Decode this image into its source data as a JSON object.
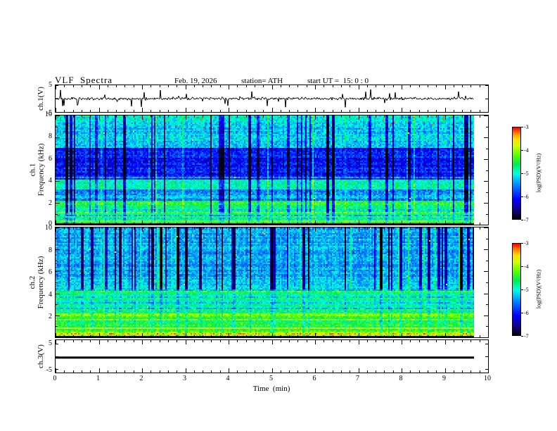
{
  "header": {
    "title": "VLF  Spectra",
    "date": "Feb. 19, 2026",
    "station": "station= ATH",
    "start_ut": "start UT =  15: 0 : 0"
  },
  "axes": {
    "time": {
      "label": "Time  (min)",
      "min": 0,
      "max": 10,
      "ticks": [
        0,
        1,
        2,
        3,
        4,
        5,
        6,
        7,
        8,
        9,
        10
      ]
    },
    "wave1": {
      "label": "ch.1(V)",
      "min": -5,
      "max": 5,
      "ticks": [
        5,
        -5
      ]
    },
    "spec1": {
      "ch": "ch.1",
      "freq_label": "Frequency  (kHz)",
      "min": 0,
      "max": 10,
      "ticks": [
        10,
        8,
        6,
        4,
        2,
        0
      ]
    },
    "spec2": {
      "ch": "ch.2",
      "freq_label": "Frequency  (kHz)",
      "min": 0,
      "max": 10,
      "ticks": [
        10,
        8,
        6,
        4,
        2
      ]
    },
    "wave3": {
      "label": "ch.3(V)",
      "min": -5,
      "max": 5,
      "ticks": [
        5,
        -5
      ]
    }
  },
  "colorbar": {
    "label": "log(PSD)(V²/Hz)",
    "ticks": [
      -3,
      -4,
      -5,
      -6,
      -7
    ],
    "min": -7,
    "max": -3
  },
  "colormap": [
    [
      0,
      0,
      0,
      0
    ],
    [
      0.1,
      20,
      0,
      130
    ],
    [
      0.22,
      0,
      0,
      255
    ],
    [
      0.38,
      0,
      140,
      255
    ],
    [
      0.5,
      0,
      255,
      230
    ],
    [
      0.6,
      0,
      235,
      90
    ],
    [
      0.7,
      90,
      255,
      0
    ],
    [
      0.8,
      210,
      255,
      0
    ],
    [
      0.88,
      255,
      220,
      0
    ],
    [
      0.94,
      255,
      130,
      0
    ],
    [
      1,
      255,
      0,
      0
    ]
  ],
  "chart_data": [
    {
      "id": "ch1-waveform",
      "type": "line",
      "panel": "ch.1(V)",
      "ylim": [
        -5,
        5
      ],
      "x_minutes": [
        0,
        9.7
      ],
      "description": "broadband noise trace near 0 V with impulsive sferic spikes to about ±4 V",
      "gen": {
        "seed": 11,
        "noise_amp": 0.55,
        "spike_prob": 0.06,
        "spike_amp": 3.6
      }
    },
    {
      "id": "ch1-spectrogram",
      "type": "heatmap",
      "panel": "ch.1 Frequency (kHz)",
      "f_khz": [
        0,
        10
      ],
      "x_minutes": [
        0,
        9.7
      ],
      "psd_log_range": [
        -7,
        -3
      ],
      "description": "VLF spectrogram: green band 7-10 kHz with red speckle at top, dark blue 4-7 kHz, bright cyan band 3.3-4.1 kHz, striped green/yellow below 2.2 kHz, black strip at 0 kHz, dense vertical sferic streaks",
      "bands": [
        [
          0,
          0.12,
          -6.9
        ],
        [
          0.12,
          0.5,
          -4.5
        ],
        [
          0.5,
          0.9,
          -4.8
        ],
        [
          0.9,
          2.2,
          -5.0
        ],
        [
          2.2,
          3.3,
          -5.5
        ],
        [
          3.3,
          4.1,
          -4.9
        ],
        [
          4.1,
          7,
          -6.0
        ],
        [
          7,
          9.3,
          -5.2
        ],
        [
          9.3,
          10,
          -4.9
        ]
      ],
      "lines": [
        [
          0.3,
          -4.0
        ],
        [
          0.7,
          -4.3
        ],
        [
          1.15,
          -4.5
        ],
        [
          1.55,
          -4.6
        ],
        [
          1.95,
          -4.6
        ],
        [
          2.6,
          -5.2
        ],
        [
          3.7,
          -4.7
        ],
        [
          4.35,
          -5.6
        ]
      ],
      "gen": {
        "seed": 21,
        "dark_prob": 0.11,
        "dark_delta": -1.2,
        "bright_prob": 0.05,
        "bright_delta": 0.55,
        "weight_f": 1.0,
        "low_weight": 0.45,
        "stripe_low_f": 2.2,
        "stripe_low": 0.5,
        "stripe_high": 0.16,
        "noise": 0.7,
        "speckle_f": 8.3,
        "speckle_prob": 0.006,
        "speckle_psd": -3.2
      }
    },
    {
      "id": "ch2-spectrogram",
      "type": "heatmap",
      "panel": "ch.2 Frequency (kHz)",
      "f_khz": [
        0,
        10
      ],
      "x_minutes": [
        0,
        9.7
      ],
      "psd_log_range": [
        -7,
        -3
      ],
      "description": "VLF spectrogram: green 5-10 kHz with strong dark vertical streaks, bright horizontally striped green/yellow region below 4.4 kHz, black strip at 0 kHz",
      "bands": [
        [
          0,
          0.12,
          -6.8
        ],
        [
          0.12,
          0.6,
          -4.3
        ],
        [
          0.6,
          1.4,
          -4.6
        ],
        [
          1.4,
          2.4,
          -4.4
        ],
        [
          2.4,
          4.4,
          -4.9
        ],
        [
          4.4,
          5.2,
          -5.1
        ],
        [
          5.2,
          10,
          -5.4
        ]
      ],
      "lines": [
        [
          0.35,
          -3.8
        ],
        [
          0.8,
          -4.2
        ],
        [
          1.15,
          -4.1
        ],
        [
          1.6,
          -4.0
        ],
        [
          2.0,
          -4.2
        ],
        [
          2.5,
          -4.6
        ],
        [
          3.1,
          -4.7
        ],
        [
          3.7,
          -4.8
        ],
        [
          4.15,
          -4.5
        ]
      ],
      "gen": {
        "seed": 33,
        "dark_prob": 0.15,
        "dark_delta": -1.4,
        "bright_prob": 0.04,
        "bright_delta": 0.5,
        "weight_f": 4.4,
        "low_weight": 0.25,
        "stripe_low_f": 4.4,
        "stripe_low": 0.55,
        "stripe_high": 0.18,
        "noise": 0.65,
        "speckle_f": 8.5,
        "speckle_prob": 0.003,
        "speckle_psd": -3.4
      }
    },
    {
      "id": "ch3-waveform",
      "type": "line",
      "panel": "ch.3(V)",
      "ylim": [
        -5,
        5
      ],
      "x_minutes": [
        0,
        9.7
      ],
      "description": "flat thick black line (no signal) near -0.5 V",
      "gen": {
        "value": -0.5
      }
    }
  ]
}
